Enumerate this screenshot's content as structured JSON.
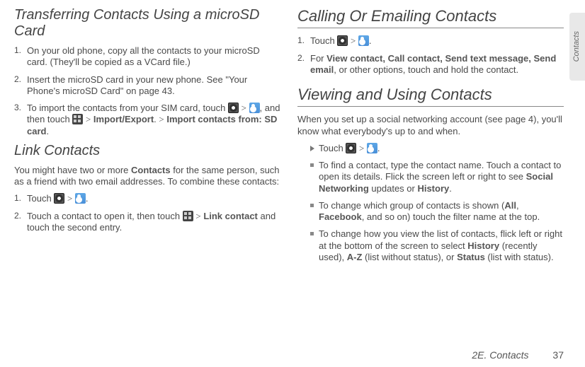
{
  "sideTab": "Contacts",
  "left": {
    "h1": "Transferring Contacts Using a microSD Card",
    "li1": "On your old phone, copy all the contacts to your microSD card. (They'll be copied as a VCard file.)",
    "li2": "Insert the microSD card in your new phone. See \"Your Phone's microSD Card\" on page 43.",
    "li3a": "To import the contacts from your SIM card, touch ",
    "li3b": ", and then touch ",
    "li3_boldA": "Import/Export",
    "li3_dot": ". ",
    "li3_boldB": "Import contacts from: SD card",
    "li3_end": ".",
    "h2": "Link Contacts",
    "p1a": "You might have two or more ",
    "p1_bold": "Contacts",
    "p1b": " for the same person, such as a friend with two email addresses. To combine these contacts:",
    "l2_1": "Touch ",
    "l2_2a": "Touch a contact to open it, then touch ",
    "l2_2_bold": "Link contact",
    "l2_2b": " and touch the second entry."
  },
  "right": {
    "h1": "Calling Or Emailing Contacts",
    "r1": "Touch ",
    "r2a": "For ",
    "r2_bold": "View contact, Call contact, Send text message, Send email",
    "r2b": ", or other options, touch and hold the contact.",
    "h2": "Viewing and Using Contacts",
    "p1": "When you set up a social networking account (see page 4), you'll know what everybody's up to and when.",
    "touch": "Touch ",
    "s1a": "To find a contact, type the contact name. Touch a contact to open its details. Flick the screen left or right to see ",
    "s1_boldA": "Social Networking",
    "s1_mid": " updates or ",
    "s1_boldB": "History",
    "s1_end": ".",
    "s2a": "To change which group of contacts is shown (",
    "s2_boldA": "All",
    "s2_mid1": ", ",
    "s2_boldB": "Facebook",
    "s2_mid2": ", and so on) touch the filter name at the top.",
    "s3a": "To change how you view the list of contacts, flick left or right at the bottom of the screen to select ",
    "s3_boldA": "History",
    "s3_mid1": " (recently used), ",
    "s3_boldB": "A-Z",
    "s3_mid2": " (list without status), or ",
    "s3_boldC": "Status",
    "s3_end": " (list with status)."
  },
  "footer": {
    "section": "2E. Contacts",
    "page": "37"
  },
  "gt": ">"
}
